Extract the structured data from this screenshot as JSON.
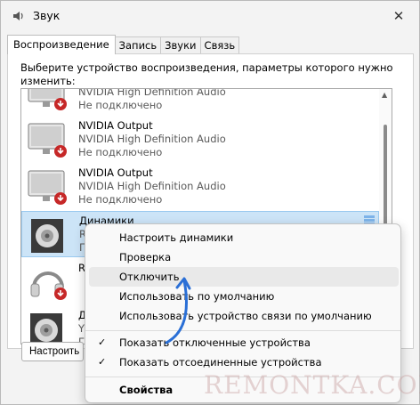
{
  "window": {
    "title": "Звук",
    "close_glyph": "✕",
    "title_icon": "speaker-icon"
  },
  "tabs": [
    {
      "label": "Воспроизведение",
      "active": true
    },
    {
      "label": "Запись",
      "active": false
    },
    {
      "label": "Звуки",
      "active": false
    },
    {
      "label": "Связь",
      "active": false
    }
  ],
  "instruction": "Выберите устройство воспроизведения, параметры которого нужно изменить:",
  "devices": [
    {
      "name": "",
      "line1": "NVIDIA High Definition Audio",
      "line2": "Не подключено",
      "icon": "monitor-icon",
      "status": "disconnected"
    },
    {
      "name": "NVIDIA Output",
      "line1": "NVIDIA High Definition Audio",
      "line2": "Не подключено",
      "icon": "monitor-icon",
      "status": "disconnected"
    },
    {
      "name": "NVIDIA Output",
      "line1": "NVIDIA High Definition Audio",
      "line2": "Не подключено",
      "icon": "monitor-icon",
      "status": "disconnected"
    },
    {
      "name": "Динамики",
      "line1": "R",
      "line2": "Г",
      "icon": "speaker-icon",
      "status": "selected"
    },
    {
      "name": "R",
      "line1": "",
      "line2": "",
      "icon": "headphones-icon",
      "status": "disconnected"
    },
    {
      "name": "Д",
      "line1": "Y",
      "line2": "Г",
      "icon": "speaker-icon",
      "status": "normal"
    }
  ],
  "buttons": {
    "configure": "Настроить"
  },
  "context_menu": {
    "items": [
      {
        "label": "Настроить динамики",
        "checked": false,
        "bold": false,
        "hover": false
      },
      {
        "label": "Проверка",
        "checked": false,
        "bold": false,
        "hover": false
      },
      {
        "label": "Отключить",
        "checked": false,
        "bold": false,
        "hover": true
      },
      {
        "label": "Использовать по умолчанию",
        "checked": false,
        "bold": false,
        "hover": false
      },
      {
        "label": "Использовать устройство связи по умолчанию",
        "checked": false,
        "bold": false,
        "hover": false
      },
      {
        "label": "Показать отключенные устройства",
        "checked": true,
        "bold": false,
        "hover": false
      },
      {
        "label": "Показать отсоединенные устройства",
        "checked": true,
        "bold": false,
        "hover": false
      },
      {
        "label": "Свойства",
        "checked": false,
        "bold": true,
        "hover": false
      }
    ],
    "check_glyph": "✓"
  },
  "watermark": "REMONTKA.COM",
  "colors": {
    "selection": "#cce4f7",
    "accent_arrow": "#2a6fd6",
    "disconnected_badge": "#c62828"
  }
}
